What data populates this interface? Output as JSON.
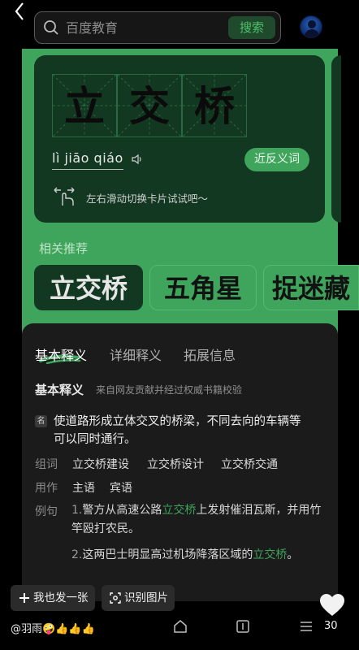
{
  "search": {
    "placeholder": "百度教育",
    "button_label": "搜索"
  },
  "word": {
    "characters": [
      "立",
      "交",
      "桥"
    ],
    "pinyin": "lì jiāo qiáo",
    "antonym_button": "近反义词",
    "swipe_tip": "左右滑动切换卡片试试吧～"
  },
  "related": {
    "title": "相关推荐",
    "items": [
      "立交桥",
      "五角星",
      "捉迷藏"
    ]
  },
  "tabs": [
    "基本释义",
    "详细释义",
    "拓展信息"
  ],
  "basic": {
    "title": "基本释义",
    "source": "来自网友贡献并经过权威书籍校验",
    "pos_badge": "名",
    "definition": "使道路形成立体交叉的桥梁，不同去向的车辆等可以同时通行。",
    "phrase_label": "组词",
    "phrases": [
      "立交桥建设",
      "立交桥设计",
      "立交桥交通"
    ],
    "usage_label": "用作",
    "usages": [
      "主语",
      "宾语"
    ],
    "example_label": "例句",
    "examples": [
      {
        "num": "1.",
        "before": "警方从高速公路",
        "highlight": "立交桥",
        "after": "上发射催泪瓦斯，并用竹竿殴打农民。"
      },
      {
        "num": "2.",
        "before": "这两巴士明显高过机场降落区域的",
        "highlight": "立交桥",
        "after": "。"
      }
    ]
  },
  "bottom": {
    "post_button": "我也发一张",
    "recognize_button": "识别图片",
    "author": "@羽雨",
    "emojis": "🤪👍👍👍",
    "like_count": "30"
  },
  "colors": {
    "accent": "#3fa45c",
    "card_dark": "#133821",
    "panel": "#1b1b1b"
  }
}
